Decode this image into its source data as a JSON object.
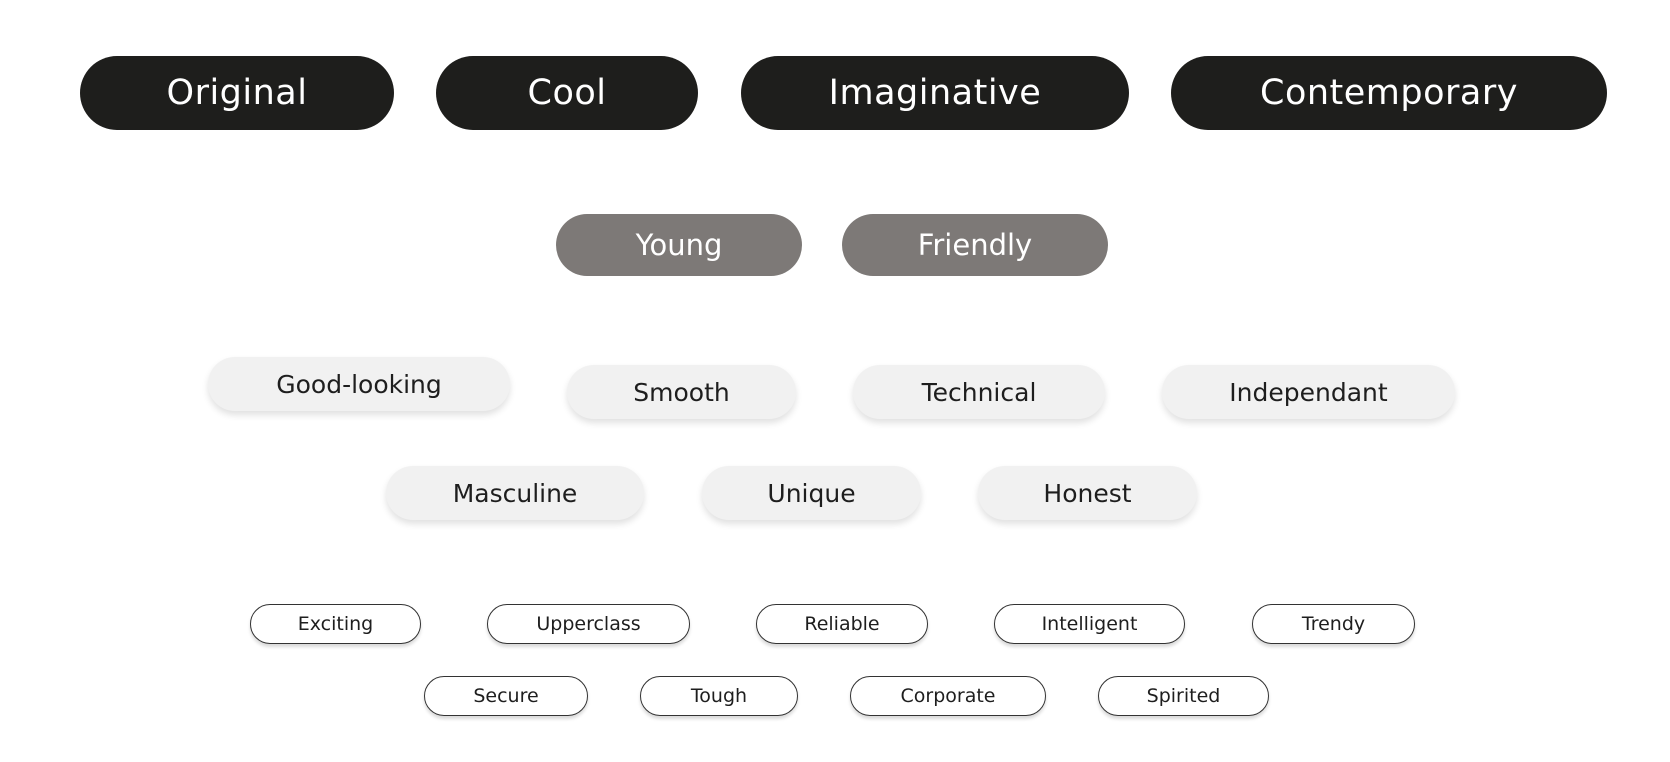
{
  "tier1": [
    "Original",
    "Cool",
    "Imaginative",
    "Contemporary"
  ],
  "tier2": [
    "Young",
    "Friendly"
  ],
  "tier3": {
    "row1": [
      "Good-looking",
      "Smooth",
      "Technical",
      "Independant"
    ],
    "row2": [
      "Masculine",
      "Unique",
      "Honest"
    ]
  },
  "tier4": {
    "row1": [
      "Exciting",
      "Upperclass",
      "Reliable",
      "Intelligent",
      "Trendy"
    ],
    "row2": [
      "Secure",
      "Tough",
      "Corporate",
      "Spirited"
    ]
  },
  "colors": {
    "tier1_bg": "#1e1e1c",
    "tier2_bg": "#7d7977",
    "tier3_bg": "#f1f1f1",
    "tier4_border": "#333333"
  }
}
